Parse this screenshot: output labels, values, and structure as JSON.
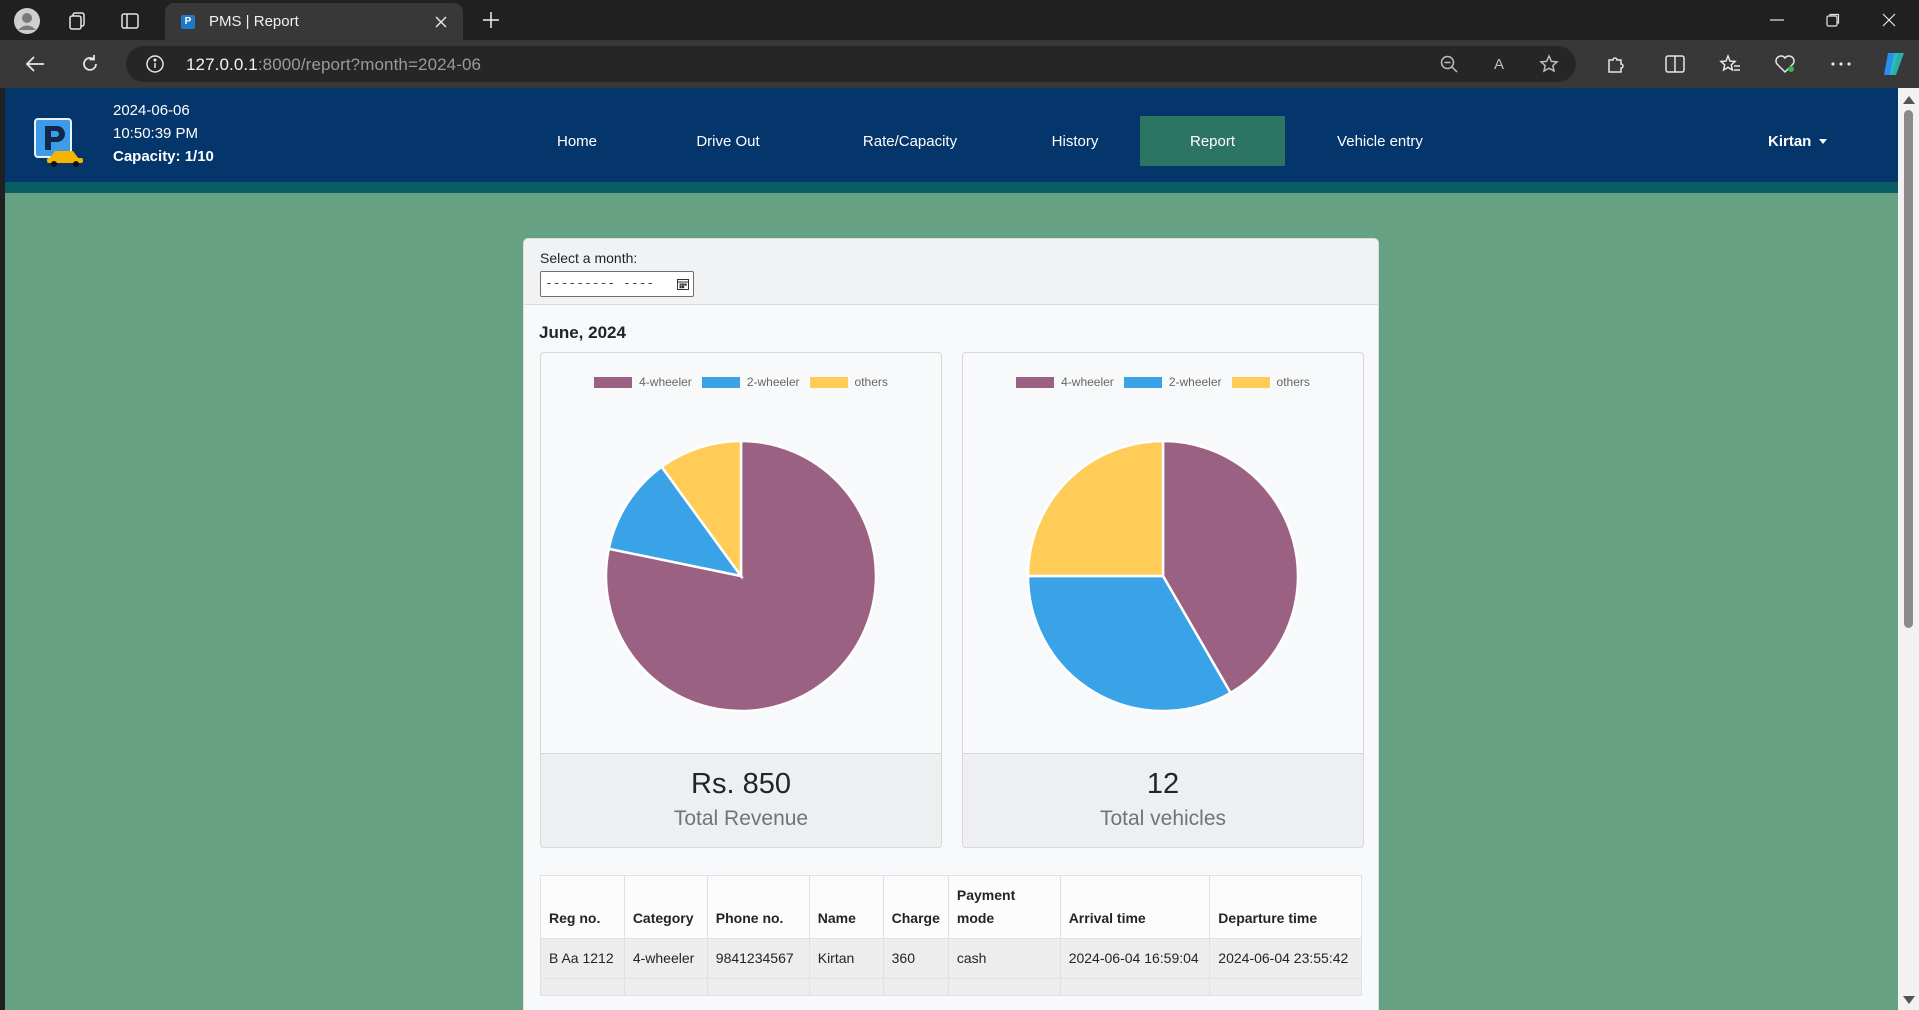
{
  "browser": {
    "tab_title": "PMS | Report",
    "url_host": "127.0.0.1",
    "url_rest": ":8000/report?month=2024-06"
  },
  "navbar": {
    "date": "2024-06-06",
    "time": "10:50:39 PM",
    "capacity": "Capacity: 1/10",
    "links": [
      "Home",
      "Drive Out",
      "Rate/Capacity",
      "History",
      "Report",
      "Vehicle entry"
    ],
    "active_link": "Report",
    "user": "Kirtan"
  },
  "report": {
    "month_label": "Select a month:",
    "month_input_placeholder": "--------- ----",
    "month_title": "June, 2024",
    "revenue_value": "Rs. 850",
    "revenue_label": "Total Revenue",
    "vehicles_value": "12",
    "vehicles_label": "Total vehicles"
  },
  "colors": {
    "four_wheeler": "#9a6183",
    "two_wheeler": "#3aa3e8",
    "others": "#ffcd57"
  },
  "chart_data": [
    {
      "type": "pie",
      "title": "",
      "categories": [
        "4-wheeler",
        "2-wheeler",
        "others"
      ],
      "values": [
        665,
        100,
        85
      ],
      "legend": "top"
    },
    {
      "type": "pie",
      "title": "",
      "categories": [
        "4-wheeler",
        "2-wheeler",
        "others"
      ],
      "values": [
        5,
        4,
        3
      ],
      "legend": "top"
    }
  ],
  "table": {
    "headers": [
      "Reg no.",
      "Category",
      "Phone no.",
      "Name",
      "Charge",
      "Payment mode",
      "Arrival time",
      "Departure time"
    ],
    "rows": [
      [
        "B Aa 1212",
        "4-wheeler",
        "9841234567",
        "Kirtan",
        "360",
        "cash",
        "2024-06-04 16:59:04",
        "2024-06-04 23:55:42"
      ]
    ]
  }
}
